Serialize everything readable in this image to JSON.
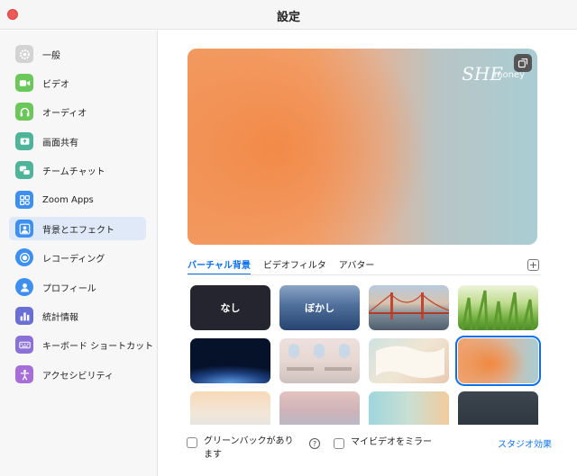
{
  "window": {
    "title": "設定"
  },
  "sidebar": {
    "items": [
      {
        "label": "一般",
        "icon": "gear-icon",
        "color": "#c9c9c9"
      },
      {
        "label": "ビデオ",
        "icon": "video-camera-icon",
        "color": "#6cc75a"
      },
      {
        "label": "オーディオ",
        "icon": "headphones-icon",
        "color": "#6cc75a"
      },
      {
        "label": "画面共有",
        "icon": "screen-share-icon",
        "color": "#4fb59a"
      },
      {
        "label": "チームチャット",
        "icon": "chat-bubbles-icon",
        "color": "#4fb59a"
      },
      {
        "label": "Zoom Apps",
        "icon": "apps-icon",
        "color": "#3d8ff0"
      },
      {
        "label": "背景とエフェクト",
        "icon": "background-person-icon",
        "color": "#3d8ff0",
        "active": true
      },
      {
        "label": "レコーディング",
        "icon": "record-icon",
        "color": "#3d8ff0"
      },
      {
        "label": "プロフィール",
        "icon": "profile-icon",
        "color": "#3d8ff0"
      },
      {
        "label": "統計情報",
        "icon": "statistics-icon",
        "color": "#6a6fd6"
      },
      {
        "label": "キーボード ショートカット",
        "icon": "keyboard-icon",
        "color": "#8b71d6"
      },
      {
        "label": "アクセシビリティ",
        "icon": "accessibility-icon",
        "color": "#a66ed6"
      }
    ]
  },
  "preview": {
    "brand": "SHE",
    "brand_sub": "money"
  },
  "tabs": [
    {
      "label": "バーチャル背景",
      "active": true
    },
    {
      "label": "ビデオフィルタ"
    },
    {
      "label": "アバター"
    }
  ],
  "thumbnails": {
    "none_label": "なし",
    "blur_label": "ぼかし"
  },
  "footer": {
    "green_screen_line1": "グリーンバックがあり",
    "green_screen_line2": "ます",
    "mirror_label": "マイビデオをミラー",
    "studio_link": "スタジオ効果"
  },
  "colors": {
    "accent": "#0e71eb"
  }
}
